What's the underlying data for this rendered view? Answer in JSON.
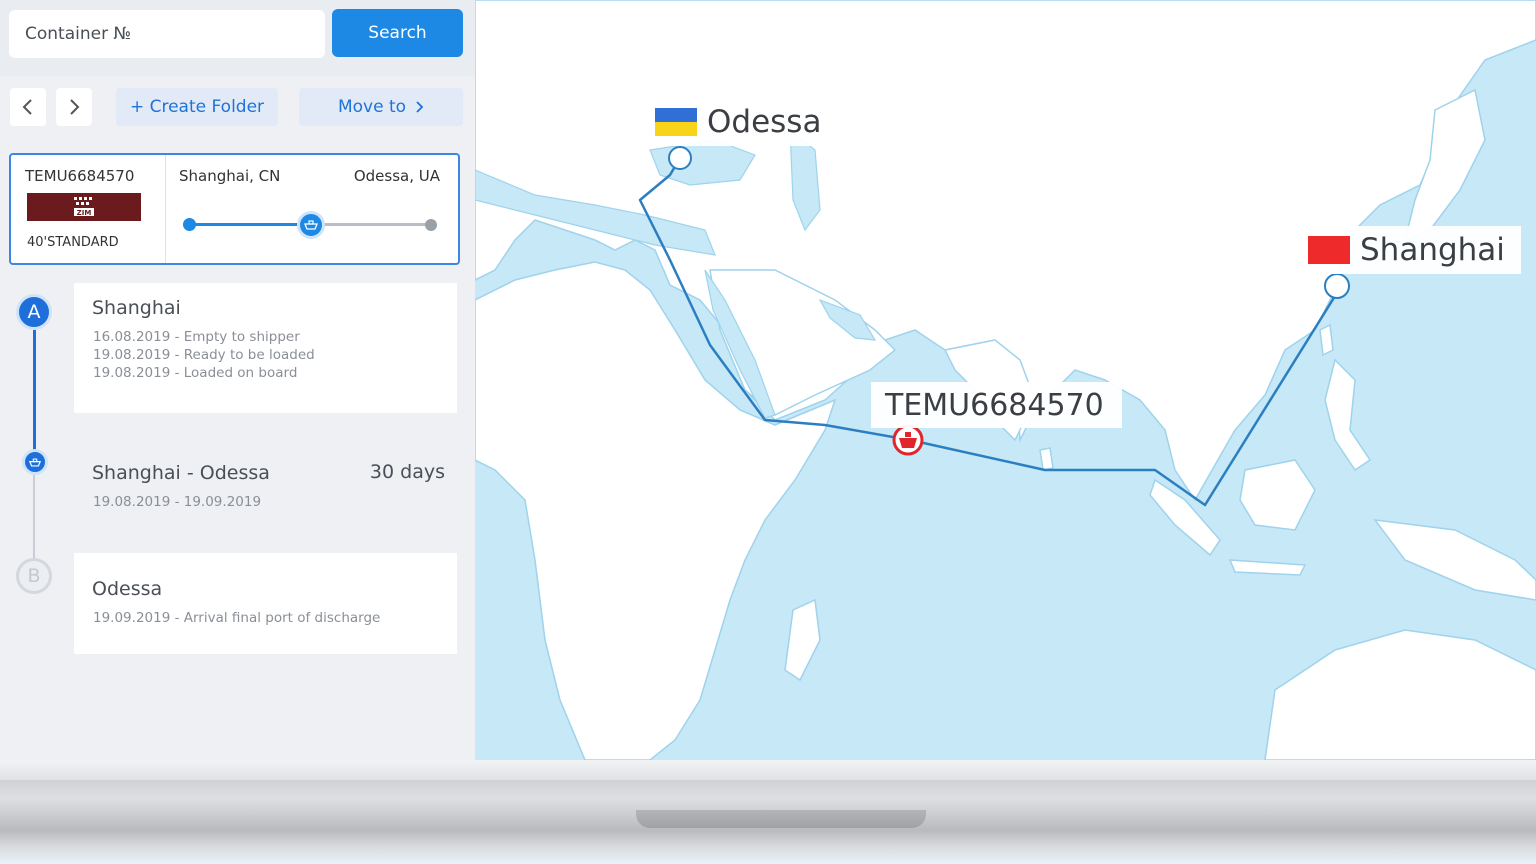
{
  "search": {
    "placeholder": "Container №",
    "button_label": "Search"
  },
  "toolbar": {
    "back_icon": "chevron-left-icon",
    "forward_icon": "chevron-right-icon",
    "create_folder_label": "+ Create Folder",
    "move_to_label": "Move to"
  },
  "container": {
    "id": "TEMU6684570",
    "carrier_logo": "ZIM",
    "type": "40'STANDARD",
    "origin": "Shanghai, CN",
    "destination": "Odessa, UA",
    "progress": 0.5
  },
  "timeline": {
    "start_marker": "A",
    "end_marker": "B",
    "origin": {
      "title": "Shanghai",
      "events": [
        "16.08.2019 - Empty to shipper",
        "19.08.2019 - Ready to be loaded",
        "19.08.2019 - Loaded on board"
      ]
    },
    "transit": {
      "title": "Shanghai - Odessa",
      "duration": "30 days",
      "dates": "19.08.2019 - 19.09.2019"
    },
    "destination": {
      "title": "Odessa",
      "events": [
        "19.09.2019 - Arrival final port of discharge"
      ]
    }
  },
  "map": {
    "origin_label": "Shanghai",
    "destination_label": "Odessa",
    "container_label": "TEMU6684570",
    "colors": {
      "water": "#c6e8f7",
      "land": "#ffffff",
      "route": "#2b7fc1",
      "vessel": "#e0262c"
    }
  },
  "colors": {
    "accent": "#1e88e5",
    "sidebar_bg": "#eef0f4"
  }
}
